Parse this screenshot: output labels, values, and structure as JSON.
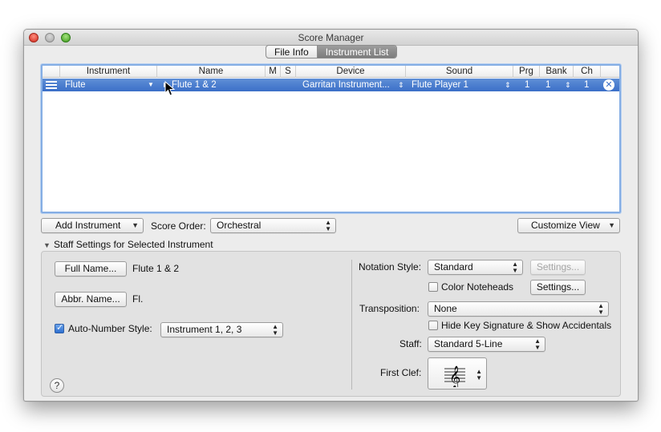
{
  "window": {
    "title": "Score Manager"
  },
  "tabs": [
    {
      "label": "File Info",
      "active": false
    },
    {
      "label": "Instrument List",
      "active": true
    }
  ],
  "table": {
    "columns": [
      "Instrument",
      "Name",
      "M",
      "S",
      "Device",
      "Sound",
      "Prg",
      "Bank",
      "Ch"
    ],
    "rows": [
      {
        "instrument": "Flute",
        "name": "Flute 1 & 2",
        "device": "Garritan Instrument...",
        "sound": "Flute Player 1",
        "prg": "1",
        "bank": "1",
        "ch": "1",
        "selected": true
      }
    ]
  },
  "toolbar": {
    "add_instrument": "Add Instrument",
    "score_order_label": "Score Order:",
    "score_order_value": "Orchestral",
    "customize_view": "Customize View"
  },
  "staff_settings": {
    "header": "Staff Settings for Selected Instrument",
    "full_name_button": "Full Name...",
    "full_name_value": "Flute 1 & 2",
    "abbr_name_button": "Abbr. Name...",
    "abbr_name_value": "Fl.",
    "auto_number_label": "Auto-Number Style:",
    "auto_number_checked": true,
    "auto_number_value": "Instrument 1, 2, 3",
    "notation_style_label": "Notation Style:",
    "notation_style_value": "Standard",
    "notation_settings_button": "Settings...",
    "color_noteheads_label": "Color Noteheads",
    "color_noteheads_checked": false,
    "color_settings_button": "Settings...",
    "transposition_label": "Transposition:",
    "transposition_value": "None",
    "hide_key_sig_label": "Hide Key Signature & Show Accidentals",
    "hide_key_sig_checked": false,
    "staff_label": "Staff:",
    "staff_value": "Standard 5-Line",
    "first_clef_label": "First Clef:",
    "first_clef_icon": "treble-clef-icon",
    "help_label": "?"
  },
  "colors": {
    "selection": "#3b6fc8",
    "focus_ring": "#85aee4",
    "panel": "#e2e2e2"
  }
}
